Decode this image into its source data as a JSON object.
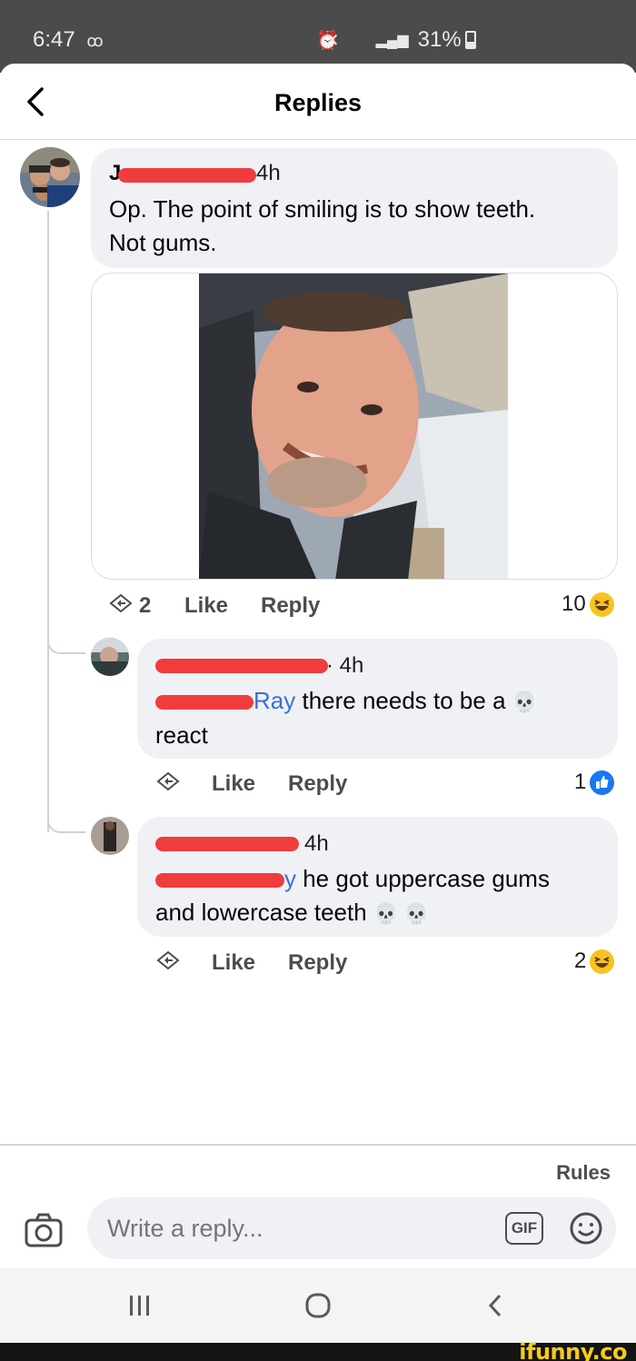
{
  "status_bar": {
    "time": "6:47",
    "battery": "31%",
    "icons": [
      "voicemail-icon",
      "alarm-icon",
      "mute-icon",
      "data-icon",
      "signal-icon",
      "battery-icon"
    ]
  },
  "header": {
    "title": "Replies",
    "back_icon": "chevron-left-icon"
  },
  "comments": [
    {
      "author_visible": "J",
      "time": "4h",
      "text": "Op. The point of smiling is to show teeth. Not gums.",
      "text_line1": "Op. The point of smiling is to show teeth.",
      "text_line2": "Not gums.",
      "has_image": true,
      "share_count": "2",
      "like_label": "Like",
      "reply_label": "Reply",
      "reaction_count": "10",
      "reaction_icon": "laughing-emoji-icon"
    },
    {
      "time": "· 4h",
      "mention": "Ray",
      "text_line1": " there needs to be a ",
      "text_emoji": "💀",
      "text_line2": "react",
      "like_label": "Like",
      "reply_label": "Reply",
      "reaction_count": "1",
      "reaction_icon": "thumbs-up-icon"
    },
    {
      "time": "4h",
      "mention": "y",
      "text_line1": " he got uppercase gums",
      "text_line2": "and lowercase teeth ",
      "text_emoji": "💀 💀",
      "like_label": "Like",
      "reply_label": "Reply",
      "reaction_count": "2",
      "reaction_icon": "laughing-emoji-icon"
    }
  ],
  "composer": {
    "rules_label": "Rules",
    "placeholder": "Write a reply...",
    "gif_label": "GIF"
  },
  "watermark": {
    "text": "ifunny.co"
  },
  "colors": {
    "bubble": "#eff1f4",
    "mention": "#3b6fd8",
    "redaction": "#f03c3c",
    "status_bar": "#4b4b4b",
    "like_blue": "#1877f2",
    "laugh_yellow": "#f7c31e"
  }
}
